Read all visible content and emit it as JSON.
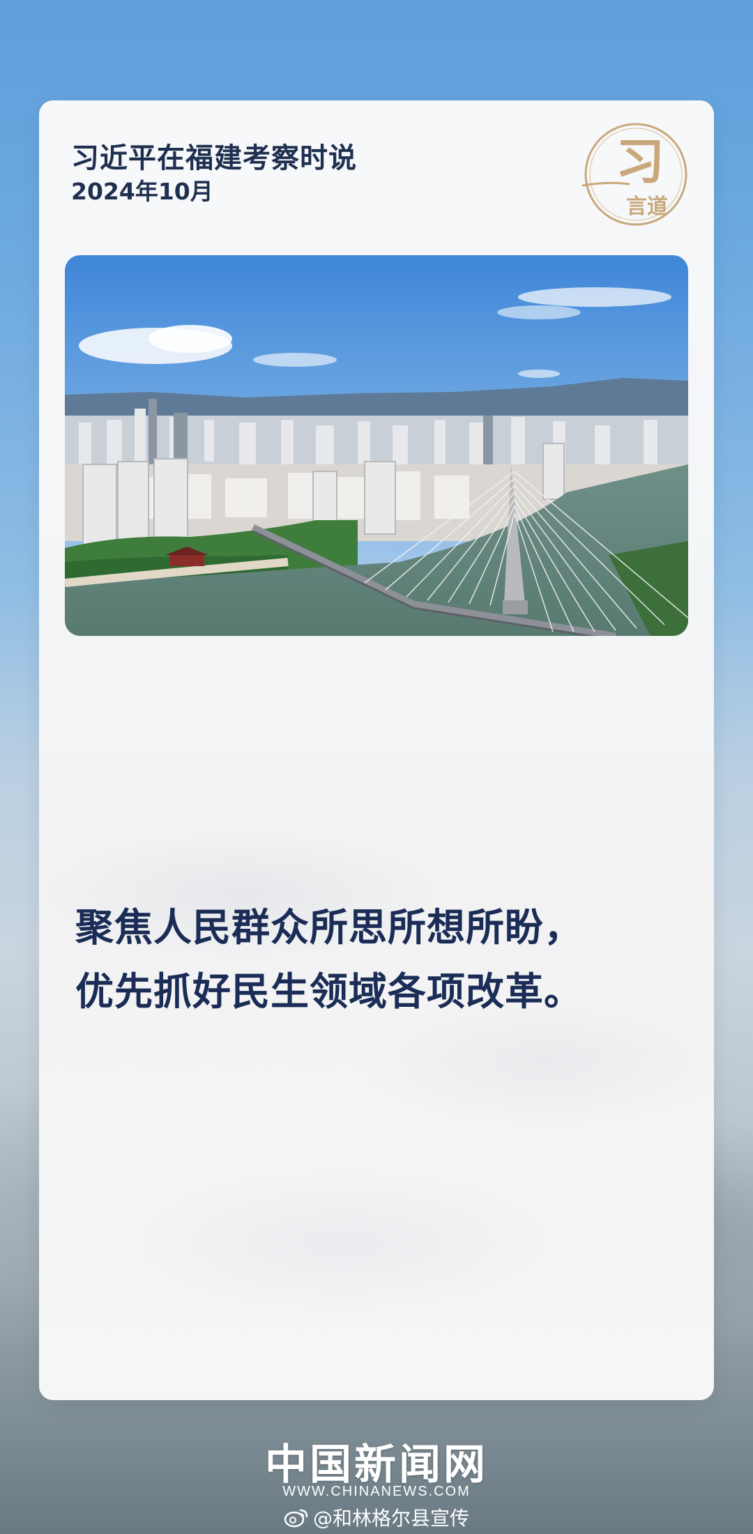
{
  "card": {
    "title": "习近平在福建考察时说",
    "date": "2024年10月",
    "seal": {
      "char_top": "习",
      "char_bottom": "言道",
      "accent_color": "#c9a77a"
    },
    "photo_icon": "city-bridge-photo",
    "quote_lines": [
      "聚焦人民群众所思所想所盼，",
      "优先抓好民生领域各项改革。"
    ]
  },
  "footer": {
    "brand": "中国新闻网",
    "url": "WWW.CHINANEWS.COM",
    "weibo_icon": "weibo-icon",
    "weibo_handle": "@和林格尔县宣传"
  },
  "colors": {
    "title": "#1f2f4f",
    "quote": "#1b2d57",
    "sky_top": "#5f9fdc"
  }
}
